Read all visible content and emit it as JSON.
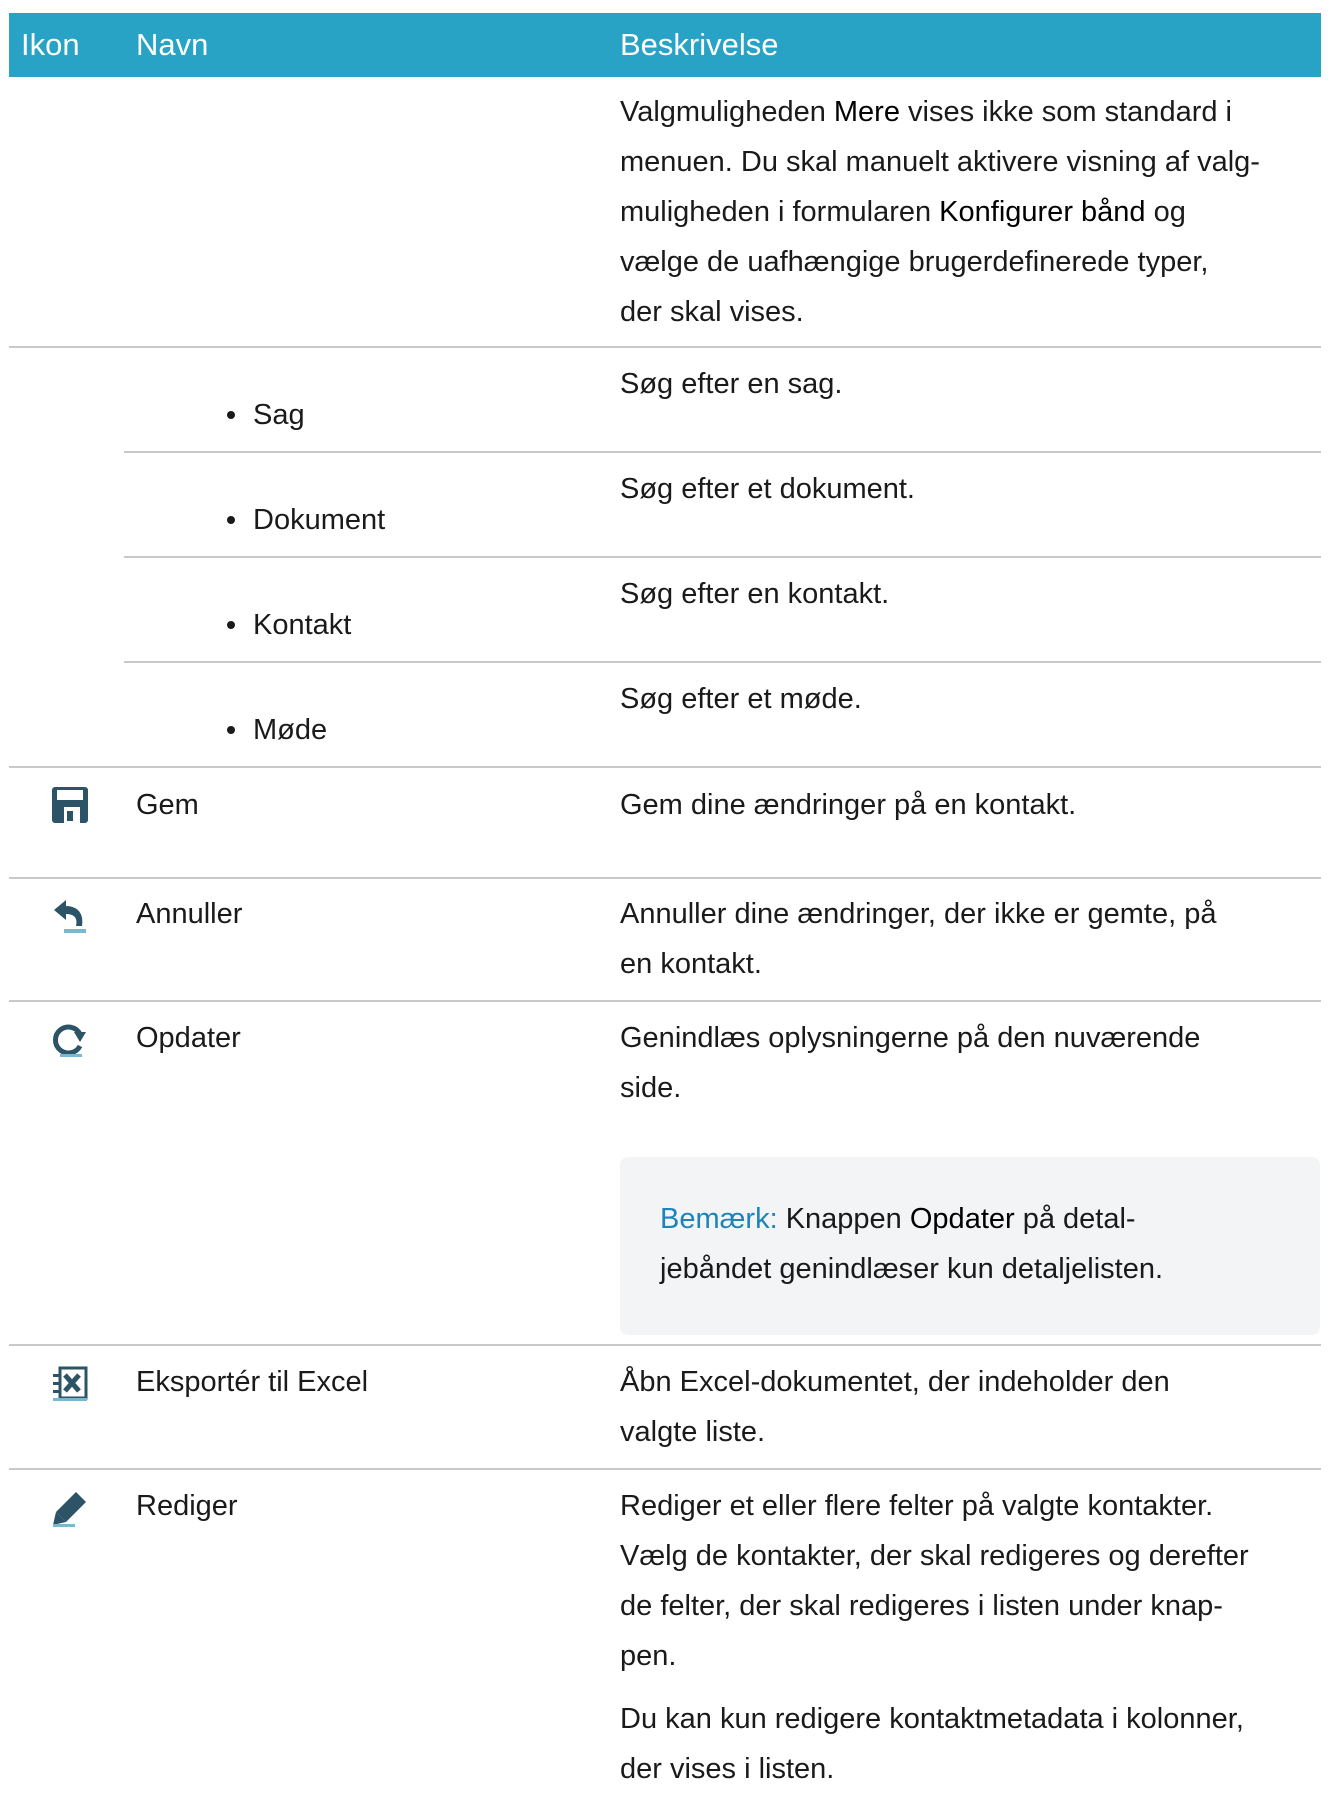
{
  "header": {
    "col_icon": "Ikon",
    "col_name": "Navn",
    "col_desc": "Beskrivelse"
  },
  "intro": {
    "l1_a": "Valgmuligheden ",
    "l1_b": "Mere",
    "l1_c": " vises ikke som standard i",
    "l2": "menuen. Du skal manuelt aktivere visning af valg-",
    "l3_a": "muligheden i formularen ",
    "l3_b": "Konfigurer bånd",
    "l3_c": " og",
    "l4": "vælge de uafhængige brugerdefinerede typer,",
    "l5": "der skal vises."
  },
  "search_items": [
    {
      "name": "Sag",
      "desc": "Søg efter en sag."
    },
    {
      "name": "Dokument",
      "desc": "Søg efter et dokument."
    },
    {
      "name": "Kontakt",
      "desc": "Søg efter en kontakt."
    },
    {
      "name": "Møde",
      "desc": "Søg efter et møde."
    }
  ],
  "rows": {
    "save": {
      "icon": "save-icon",
      "name": "Gem",
      "desc_l1": "Gem dine ændringer på en kontakt."
    },
    "cancel": {
      "icon": "undo-icon",
      "name": "Annuller",
      "desc_l1": "Annuller dine ændringer, der ikke er gemte, på",
      "desc_l2": "en kontakt."
    },
    "refresh": {
      "icon": "refresh-icon",
      "name": "Opdater",
      "desc_l1": "Genindlæs oplysningerne på den nuværende",
      "desc_l2": "side.",
      "note_label": "Bemærk:",
      "note_l1_a": " Knappen ",
      "note_l1_b": "Opdater",
      "note_l1_c": " på detal-",
      "note_l2": "jebåndet genindlæser kun detaljelisten."
    },
    "export": {
      "icon": "excel-icon",
      "name": "Eksportér til Excel",
      "desc_l1": "Åbn Excel-dokumentet, der indeholder den",
      "desc_l2": "valgte liste."
    },
    "edit": {
      "icon": "pencil-icon",
      "name": "Rediger",
      "desc_l1": "Rediger et eller flere felter på valgte kontakter.",
      "desc_l2": "Vælg de kontakter, der skal redigeres og derefter",
      "desc_l3": "de felter, der skal redigeres i listen under knap-",
      "desc_l4": "pen.",
      "desc_p2_l1": "Du kan kun redigere kontaktmetadata i kolonner,",
      "desc_p2_l2": "der vises i listen."
    }
  },
  "colors": {
    "header_bg": "#28a3c6",
    "note_label": "#1e83b8",
    "note_bg": "#f3f4f6",
    "icon": "#2c5466"
  }
}
